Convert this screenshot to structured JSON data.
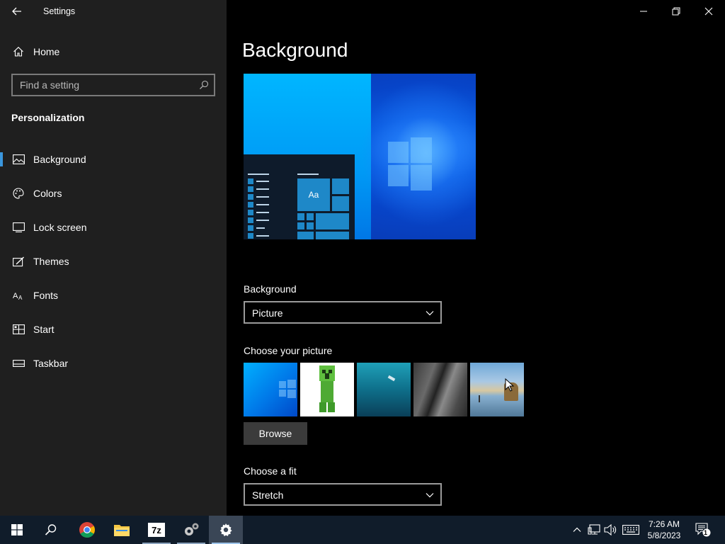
{
  "window": {
    "title": "Settings"
  },
  "sidebar": {
    "home_label": "Home",
    "search_placeholder": "Find a setting",
    "section_title": "Personalization",
    "items": [
      {
        "label": "Background",
        "icon": "picture-icon",
        "active": true
      },
      {
        "label": "Colors",
        "icon": "palette-icon",
        "active": false
      },
      {
        "label": "Lock screen",
        "icon": "lock-screen-icon",
        "active": false
      },
      {
        "label": "Themes",
        "icon": "themes-icon",
        "active": false
      },
      {
        "label": "Fonts",
        "icon": "fonts-icon",
        "active": false
      },
      {
        "label": "Start",
        "icon": "start-icon",
        "active": false
      },
      {
        "label": "Taskbar",
        "icon": "taskbar-icon",
        "active": false
      }
    ]
  },
  "main": {
    "page_title": "Background",
    "background_label": "Background",
    "background_value": "Picture",
    "choose_picture_label": "Choose your picture",
    "pictures": [
      "windows-blue",
      "creeper",
      "underwater-swimmer",
      "rock-cliff",
      "beach-rocks"
    ],
    "browse_label": "Browse",
    "fit_label": "Choose a fit",
    "fit_value": "Stretch",
    "preview_tile_text": "Aa"
  },
  "taskbar": {
    "apps": [
      "start",
      "search",
      "chrome",
      "file-explorer",
      "7zip",
      "settings-tool",
      "settings"
    ],
    "sevenzip_text": "7z",
    "time": "7:26 AM",
    "date": "5/8/2023",
    "notification_count": "1"
  },
  "colors": {
    "accent": "#3a96dd",
    "sidebar_bg": "#1f1f1f",
    "main_bg": "#000000",
    "taskbar_bg": "#101c2a"
  }
}
